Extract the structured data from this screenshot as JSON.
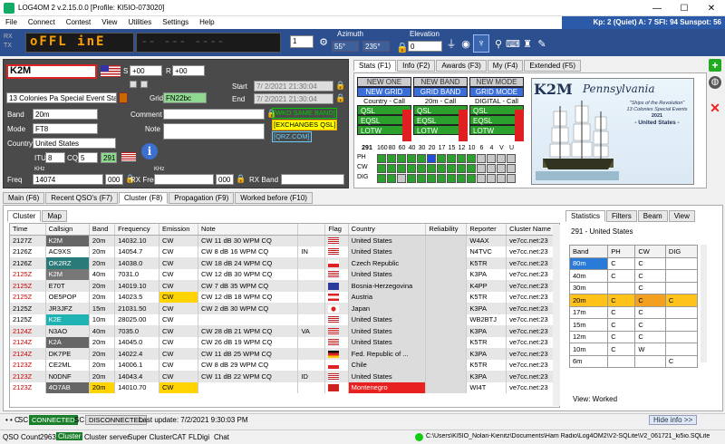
{
  "title": "LOG4OM 2 v.2.15.0.0 [Profile: KI5IO-073020]",
  "menu": [
    "File",
    "Connect",
    "Contest",
    "View",
    "Utilities",
    "Settings",
    "Help"
  ],
  "kp": "Kp: 2 (Quiet)  A: 7  SFI: 94  Sunspot: 56",
  "rx": "RX",
  "tx": "TX",
  "led_text": "oFFL inE",
  "spin": "1",
  "azimuth_label": "Azimuth",
  "az1": "55°",
  "az2": "235°",
  "elevation_label": "Elevation",
  "elev": "0",
  "callsign": "K2M",
  "s_label": "S",
  "s_val": "+00",
  "r_label": "R",
  "r_val": "+00",
  "start_label": "Start",
  "start": "7/ 2/2021 21:30:04",
  "end_label": "End",
  "end": "7/ 2/2021 21:30:04",
  "name": "13 Colonies Pa Special Event Station",
  "grid_label": "Grid",
  "grid": "FN22bc",
  "band_label": "Band",
  "band": "20m",
  "mode_label": "Mode",
  "mode": "FT8",
  "country_label": "Country",
  "country": "United States",
  "itu_label": "ITU",
  "itu": "8",
  "cq_label": "CQ",
  "cq": "5",
  "dxcc": "291",
  "comment_label": "Comment",
  "note_label": "Note",
  "links": [
    "[WKD SAME BAND]",
    "[EXCHANGES QSL]",
    "[QRZ.COM]"
  ],
  "freq_label": "Freq",
  "khz": "KHz",
  "freq": "14074",
  "freq_sub": "000",
  "rxfreq_label": "RX Freq",
  "rxfreq_sub": "000",
  "rxband_label": "RX Band",
  "stats_tabs": [
    "Stats (F1)",
    "Info (F2)",
    "Awards (F3)",
    "My (F4)",
    "Extended (F5)"
  ],
  "stat_cols": [
    {
      "h1": "NEW ONE",
      "h2": "NEW GRID",
      "sub": "Country - Call"
    },
    {
      "h1": "NEW BAND",
      "h2": "GRID BAND",
      "sub": "20m - Call"
    },
    {
      "h1": "NEW MODE",
      "h2": "GRID MODE",
      "sub": "DIGITAL - Call"
    }
  ],
  "qsl_labels": [
    "QSL",
    "EQSL",
    "LOTW"
  ],
  "grid_header": [
    "291",
    "160",
    "80",
    "60",
    "40",
    "30",
    "20",
    "17",
    "15",
    "12",
    "10",
    "6",
    "4",
    "V",
    "U"
  ],
  "grid_rows": [
    "PH",
    "CW",
    "DIG"
  ],
  "qsl_card": {
    "call": "K2M",
    "state": "Pennsylvania",
    "line1": "\"Ships of the Revolution\"",
    "line2": "13 Colonies Special Events",
    "line3": "2021",
    "line4": "- United States -"
  },
  "bottom_tabs": [
    "Main (F6)",
    "Recent QSO's (F7)",
    "Cluster (F8)",
    "Propagation (F9)",
    "Worked before (F10)"
  ],
  "cluster_tabs": [
    "Cluster",
    "Map"
  ],
  "cluster_headers": [
    "Time",
    "Callsign",
    "Band",
    "Frequency",
    "Emission",
    "Note",
    "",
    "Flag",
    "Country",
    "Reliability",
    "Reporter",
    "Cluster Name"
  ],
  "cluster_rows": [
    [
      "2127Z",
      "K2M",
      "20m",
      "14032.10",
      "CW",
      "CW 11 dB 30 WPM CQ",
      "",
      "us",
      "United States",
      "",
      "W4AX",
      "ve7cc.net:23"
    ],
    [
      "2126Z",
      "AC9XS",
      "20m",
      "14054.7",
      "CW",
      "CW 8 dB 16 WPM CQ",
      "IN",
      "us",
      "United States",
      "",
      "N4TVC",
      "ve7cc.net:23"
    ],
    [
      "2126Z",
      "OK2RZ",
      "20m",
      "14038.0",
      "CW",
      "CW 18 dB 24 WPM CQ",
      "",
      "cz",
      "Czech Republic",
      "",
      "K5TR",
      "ve7cc.net:23"
    ],
    [
      "2125Z",
      "K2M",
      "40m",
      "7031.0",
      "CW",
      "CW 12 dB 30 WPM CQ",
      "",
      "us",
      "United States",
      "",
      "K3PA",
      "ve7cc.net:23"
    ],
    [
      "2125Z",
      "E70T",
      "20m",
      "14019.10",
      "CW",
      "CW 7 dB 35 WPM CQ",
      "",
      "ba",
      "Bosnia-Herzegovina",
      "",
      "K4PP",
      "ve7cc.net:23"
    ],
    [
      "2125Z",
      "OE5POP",
      "20m",
      "14023.5",
      "CW",
      "CW 12 dB 18 WPM CQ",
      "",
      "at",
      "Austria",
      "",
      "K5TR",
      "ve7cc.net:23"
    ],
    [
      "2125Z",
      "JR3JFZ",
      "15m",
      "21031.50",
      "CW",
      "CW 2 dB 30 WPM CQ",
      "",
      "jp",
      "Japan",
      "",
      "K3PA",
      "ve7cc.net:23"
    ],
    [
      "2125Z",
      "K2E",
      "10m",
      "28025.00",
      "CW",
      "",
      "",
      "us",
      "United States",
      "",
      "WB2BTJ",
      "ve7cc.net:23"
    ],
    [
      "2124Z",
      "N3AO",
      "40m",
      "7035.0",
      "CW",
      "CW 28 dB 21 WPM CQ",
      "VA",
      "us",
      "United States",
      "",
      "K3PA",
      "ve7cc.net:23"
    ],
    [
      "2124Z",
      "K2A",
      "20m",
      "14045.0",
      "CW",
      "CW 26 dB 19 WPM CQ",
      "",
      "us",
      "United States",
      "",
      "K5TR",
      "ve7cc.net:23"
    ],
    [
      "2124Z",
      "DK7PE",
      "20m",
      "14022.4",
      "CW",
      "CW 11 dB 25 WPM CQ",
      "",
      "de",
      "Fed. Republic of ...",
      "",
      "K3PA",
      "ve7cc.net:23"
    ],
    [
      "2123Z",
      "CE2ML",
      "20m",
      "14006.1",
      "CW",
      "CW 8 dB 29 WPM CQ",
      "",
      "cl",
      "Chile",
      "",
      "K5TR",
      "ve7cc.net:23"
    ],
    [
      "2123Z",
      "N0DNF",
      "20m",
      "14043.4",
      "CW",
      "CW 11 dB 22 WPM CQ",
      "ID",
      "us",
      "United States",
      "",
      "K3PA",
      "ve7cc.net:23"
    ],
    [
      "2123Z",
      "4O7AB",
      "20m",
      "14010.70",
      "CW",
      "",
      "",
      "me",
      "Montenegro",
      "",
      "WI4T",
      "ve7cc.net:23"
    ]
  ],
  "stats_side_tabs": [
    "Statistics",
    "Filters",
    "Beam",
    "View"
  ],
  "side_country": "291 - United States",
  "side_headers": [
    "Band",
    "PH",
    "CW",
    "DIG"
  ],
  "side_rows": [
    [
      "80m",
      "C",
      "C",
      ""
    ],
    [
      "40m",
      "C",
      "C",
      ""
    ],
    [
      "30m",
      "",
      "C",
      ""
    ],
    [
      "20m",
      "C",
      "C",
      "C"
    ],
    [
      "17m",
      "C",
      "C",
      ""
    ],
    [
      "15m",
      "C",
      "C",
      ""
    ],
    [
      "12m",
      "C",
      "C",
      ""
    ],
    [
      "10m",
      "C",
      "W",
      ""
    ],
    [
      "6m",
      "",
      "",
      "C"
    ]
  ],
  "view_label": "View:",
  "view_val": "Worked",
  "sc": "SC",
  "connected": "CONNECTED",
  "disconnected": "DISCONNECTED",
  "last_update": "Last update: 7/2/2021 9:30:03 PM",
  "hide_info": "Hide info >>",
  "qso_count_label": "QSO Count",
  "qso_count": "2963",
  "bottom_items": [
    "Cluster",
    "Cluster server",
    "Super Cluster",
    "CAT",
    "FLDigi",
    "Chat"
  ],
  "db_path": "C:\\Users\\KI5IO_Nolan-Kienitz\\Documents\\Ham Radio\\Log4OM2\\V2-SQLite\\V2_061721_ki5io.SQLite"
}
